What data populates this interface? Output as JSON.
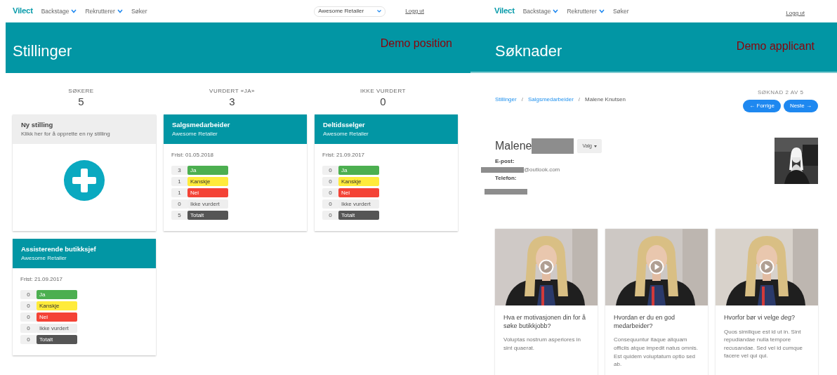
{
  "left": {
    "nav": {
      "logo": "Vilect",
      "items": [
        {
          "label": "Backstage",
          "dropdown": true
        },
        {
          "label": "Rekrutterer",
          "dropdown": true
        },
        {
          "label": "Søker",
          "dropdown": false
        }
      ],
      "company_select": {
        "value": "Awesome Retailer"
      },
      "logout": "Logg ut"
    },
    "header": {
      "title": "Stillinger",
      "overlay": "Demo position"
    },
    "stats": [
      {
        "label": "SØKERE",
        "value": "5"
      },
      {
        "label": "VURDERT «JA»",
        "value": "3"
      },
      {
        "label": "IKKE VURDERT",
        "value": "0"
      }
    ],
    "new_card": {
      "title": "Ny stilling",
      "subtitle": "Klikk her for å opprette en ny stilling"
    },
    "positions": [
      {
        "title": "Salgsmedarbeider",
        "company": "Awesome Retailer",
        "deadline": "Frist: 01.05.2018",
        "counts": [
          {
            "count": "3",
            "label": "Ja",
            "color": "#4caf50"
          },
          {
            "count": "1",
            "label": "Kanskje",
            "color": "#ffeb3b"
          },
          {
            "count": "1",
            "label": "Nei",
            "color": "#f44336"
          },
          {
            "count": "0",
            "label": "Ikke vurdert",
            "color": "#eeeeee"
          },
          {
            "count": "5",
            "label": "Totalt",
            "color": "#555555"
          }
        ]
      },
      {
        "title": "Deltidsselger",
        "company": "Awesome Retailer",
        "deadline": "Frist: 21.09.2017",
        "counts": [
          {
            "count": "0",
            "label": "Ja",
            "color": "#4caf50"
          },
          {
            "count": "0",
            "label": "Kanskje",
            "color": "#ffeb3b"
          },
          {
            "count": "0",
            "label": "Nei",
            "color": "#f44336"
          },
          {
            "count": "0",
            "label": "Ikke vurdert",
            "color": "#eeeeee"
          },
          {
            "count": "0",
            "label": "Totalt",
            "color": "#555555"
          }
        ]
      },
      {
        "title": "Assisterende butikksjef",
        "company": "Awesome Retailer",
        "deadline": "Frist: 21.09.2017",
        "counts": [
          {
            "count": "0",
            "label": "Ja",
            "color": "#4caf50"
          },
          {
            "count": "0",
            "label": "Kanskje",
            "color": "#ffeb3b"
          },
          {
            "count": "0",
            "label": "Nei",
            "color": "#f44336"
          },
          {
            "count": "0",
            "label": "Ikke vurdert",
            "color": "#eeeeee"
          },
          {
            "count": "0",
            "label": "Totalt",
            "color": "#555555"
          }
        ]
      }
    ]
  },
  "right": {
    "nav": {
      "logo": "Vilect",
      "items": [
        {
          "label": "Backstage",
          "dropdown": true
        },
        {
          "label": "Rekrutterer",
          "dropdown": true
        },
        {
          "label": "Søker",
          "dropdown": false
        }
      ],
      "logout": "Logg ut"
    },
    "header": {
      "title": "Søknader",
      "overlay": "Demo applicant"
    },
    "breadcrumb": [
      {
        "kind": "link",
        "label": "Stillinger"
      },
      {
        "kind": "separator",
        "label": "/"
      },
      {
        "kind": "link",
        "label": "Salgsmedarbeider"
      },
      {
        "kind": "separator",
        "label": "/"
      },
      {
        "kind": "current",
        "label": "Malene Knutsen"
      }
    ],
    "pager": {
      "label": "SØKNAD 2 AV 5",
      "prev": "← Forrige",
      "next": "Neste →"
    },
    "applicant": {
      "first_name": "Malene",
      "menu": "Valg",
      "email_label": "E-post:",
      "email": "@outlook.com",
      "phone_label": "Telefon:"
    },
    "videos": [
      {
        "question": "Hva er motivasjonen din for å søke butikkjobb?",
        "description": "Voluptas nostrum asperiores in sint quaerat."
      },
      {
        "question": "Hvordan er du en god medarbeider?",
        "description": "Consequuntur itaque aliquam officiis atque impedit natus omnis. Est quidem voluptatum optio sed ab."
      },
      {
        "question": "Hvorfor bør vi velge deg?",
        "description": "Quos similique est id ut in. Sint repudiandae nulla tempore recusandae. Sed vel id cumque facere vel qui qui."
      }
    ]
  }
}
